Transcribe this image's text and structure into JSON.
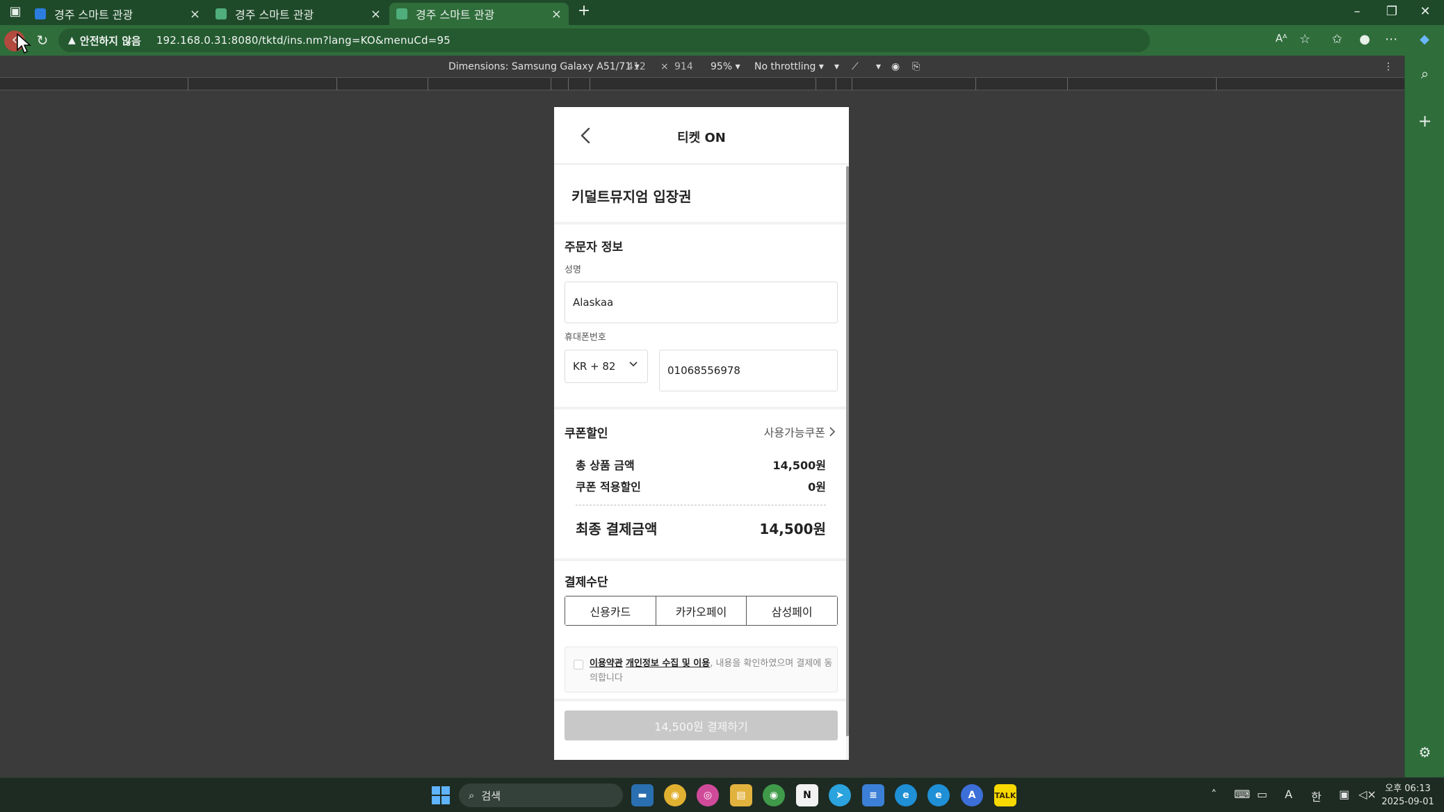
{
  "browser": {
    "tabs": [
      {
        "title": "경주 스마트 관광",
        "active": false
      },
      {
        "title": "경주 스마트 관광",
        "active": false
      },
      {
        "title": "경주 스마트 관광",
        "active": true
      }
    ],
    "security_label": "안전하지 않음",
    "url": "192.168.0.31:8080/tktd/ins.nm?lang=KO&menuCd=95"
  },
  "devtools": {
    "dimensions_label": "Dimensions: Samsung Galaxy A51/71",
    "width": "412",
    "times": "×",
    "height": "914",
    "zoom": "95%",
    "throttling": "No throttling"
  },
  "app": {
    "header_title": "티켓 ON",
    "product_title": "키덜트뮤지엄 입장권",
    "orderer": {
      "section_title": "주문자 정보",
      "name_label": "성명",
      "name_value": "Alaskaa",
      "phone_label": "휴대폰번호",
      "country_code": "KR + 82",
      "phone_value": "01068556978"
    },
    "coupon": {
      "section_title": "쿠폰할인",
      "available_link": "사용가능쿠폰",
      "total_label": "총 상품 금액",
      "total_value": "14,500원",
      "discount_label": "쿠폰 적용할인",
      "discount_value": "0원",
      "final_label": "최종 결제금액",
      "final_value": "14,500원"
    },
    "payment": {
      "section_title": "결제수단",
      "methods": [
        "신용카드",
        "카카오페이",
        "삼성페이"
      ]
    },
    "agreement": {
      "terms_link": "이용약관",
      "privacy_link": "개인정보 수집 및 이용",
      "text": ", 내용을 확인하였으며 결제에 동의합니다"
    },
    "submit_label": "14,500원 결제하기"
  },
  "taskbar": {
    "search_placeholder": "검색",
    "clock_time": "오후 06:13",
    "clock_date": "2025-09-01",
    "ime_lang": "한",
    "ime_font": "A"
  },
  "colors": {
    "browser_frame": "#2f6d3b",
    "tab_strip": "#1f4a2a",
    "viewport_bg": "#3b3b3b",
    "submit_disabled": "#c8c8c8"
  }
}
